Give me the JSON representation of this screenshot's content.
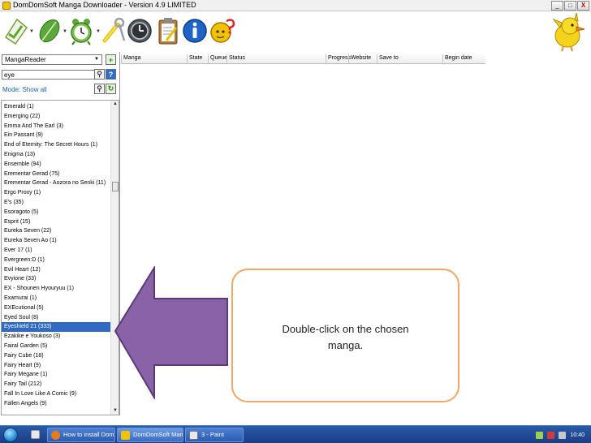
{
  "window": {
    "title": "DomDomSoft Manga Downloader - Version 4.9 LIMITED",
    "controls": {
      "minimize": "_",
      "maximize": "□",
      "close": "X"
    }
  },
  "toolbar": {
    "buttons": [
      {
        "name": "add-manga-icon",
        "has_dropdown": true
      },
      {
        "name": "download-leaf-icon",
        "has_dropdown": true
      },
      {
        "name": "alarm-clock-icon",
        "has_dropdown": true
      },
      {
        "name": "settings-wrench-icon",
        "has_dropdown": false
      },
      {
        "name": "history-clock-icon",
        "has_dropdown": false
      },
      {
        "name": "clipboard-icon",
        "has_dropdown": false
      },
      {
        "name": "info-icon",
        "has_dropdown": false
      },
      {
        "name": "help-question-icon",
        "has_dropdown": false
      }
    ],
    "dropdown_glyph": "▼"
  },
  "sidebar": {
    "source": "MangaReader",
    "source_caret": "▼",
    "add_glyph": "+",
    "search_value": "eye",
    "search_glyph": "⚲",
    "help_glyph": "?",
    "refresh_glyph": "↻",
    "mode": "Mode: Show all",
    "scroll_up": "▲",
    "scroll_down": "▼",
    "items": [
      "Emerald (1)",
      "Emerging (22)",
      "Emma And The Earl (3)",
      "Ein Passant (9)",
      "End of Eternity: The Secret Hours (1)",
      "Enigma (13)",
      "Ensemble (94)",
      "Erementar Gerad (75)",
      "Erementar Gerad - Aozora no Senki (11)",
      "Ergo Proxy (1)",
      "E's (35)",
      "Esoragoto (5)",
      "Esprit (15)",
      "Eureka Seven (22)",
      "Eureka Seven Ao (1)",
      "Ever 17 (1)",
      "Evergreen:D (1)",
      "Evil Heart (12)",
      "Evyione (33)",
      "EX - Shounen Hyouryuu (1)",
      "Examurai (1)",
      "EXEcutional (5)",
      "Eyed Soul (8)",
      "Eyeshield 21 (333)",
      "Ezakike e Youkoso (3)",
      "Fairal Garden (5)",
      "Fairy Cube (18)",
      "Fairy Heart (9)",
      "Fairy Megane (1)",
      "Fairy Tail (212)",
      "Fall In Love Like A Comic (9)",
      "Fallen Angels (9)"
    ],
    "selected_index": 23
  },
  "table": {
    "columns": [
      "Manga",
      "State",
      "Queue",
      "Status",
      "Progress",
      "Website",
      "Save to",
      "Begin date"
    ]
  },
  "callout": {
    "text": "Double-click on the chosen manga."
  },
  "taskbar": {
    "tasks": [
      "How to install DomD...",
      "DomDomSoft Mang...",
      "3 - Paint"
    ],
    "clock": "10:40"
  },
  "colors": {
    "selection": "#316ac5",
    "callout_border": "#f0a868",
    "arrow_fill": "#8a62a8",
    "arrow_stroke": "#5a3a78",
    "taskbar": "#1b3e86",
    "mode_text": "#1a5db8"
  }
}
